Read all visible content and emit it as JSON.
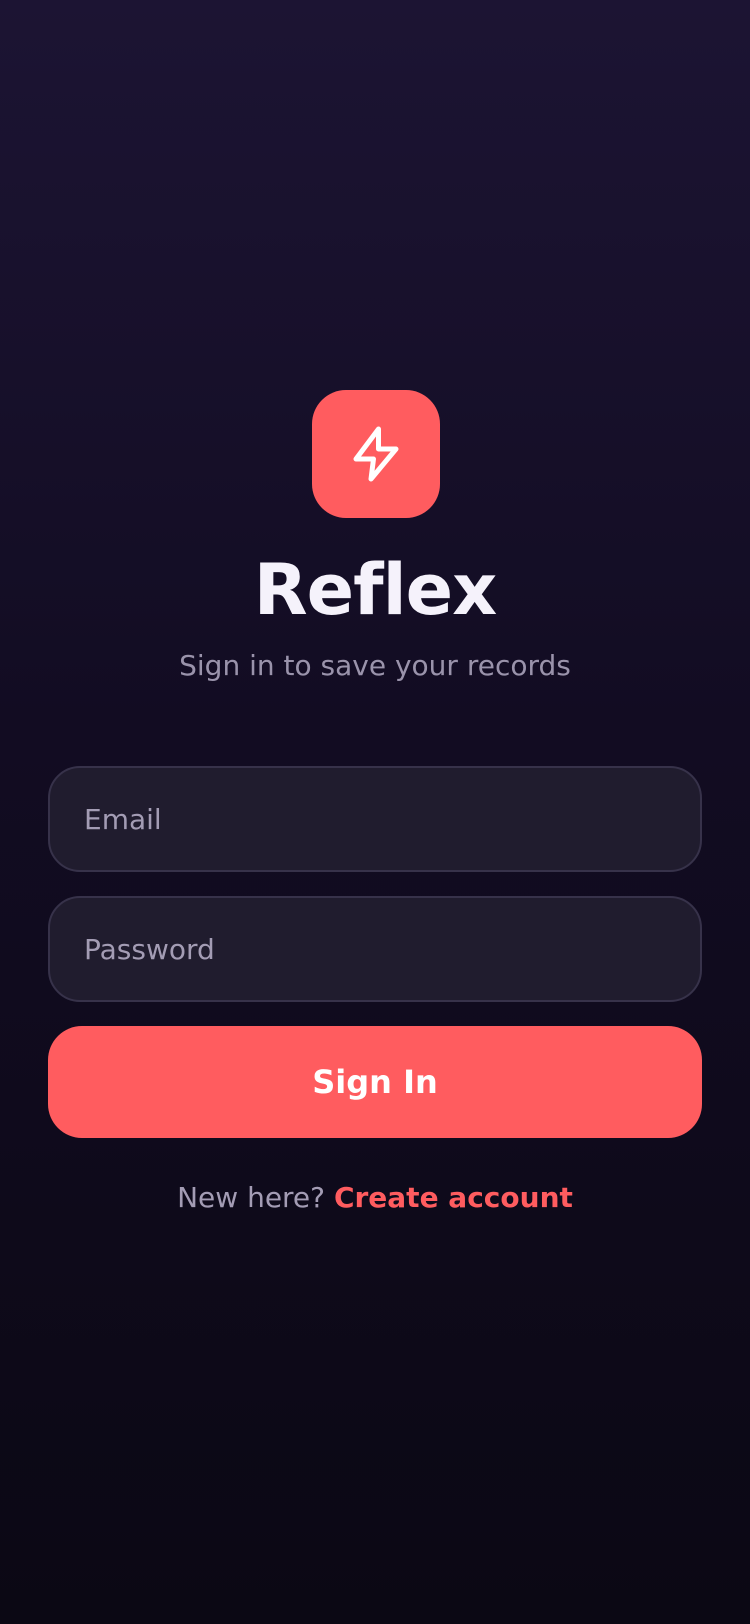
{
  "app": {
    "title": "Reflex",
    "subtitle": "Sign in to save your records",
    "logo_icon": "lightning-bolt-icon",
    "accent_color": "#ff5c5f"
  },
  "form": {
    "email_placeholder": "Email",
    "password_placeholder": "Password",
    "submit_label": "Sign In"
  },
  "footer": {
    "prompt": "New here?",
    "link_label": "Create account"
  }
}
